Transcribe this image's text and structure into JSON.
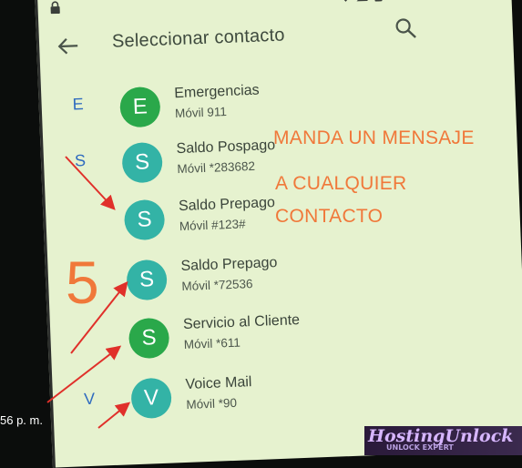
{
  "app": {
    "title": "Seleccionar contacto"
  },
  "contacts": [
    {
      "section": "E",
      "avatar": "E",
      "name": "Emergencias",
      "phone": "Móvil 911",
      "color": "#2aa84a"
    },
    {
      "section": "S",
      "avatar": "S",
      "name": "Saldo Pospago",
      "phone": "Móvil *283682",
      "color": "#33b3a6"
    },
    {
      "section": "",
      "avatar": "S",
      "name": "Saldo Prepago",
      "phone": "Móvil #123#",
      "color": "#33b3a6"
    },
    {
      "section": "",
      "avatar": "S",
      "name": "Saldo Prepago",
      "phone": "Móvil *72536",
      "color": "#33b3a6"
    },
    {
      "section": "",
      "avatar": "S",
      "name": "Servicio al Cliente",
      "phone": "Móvil *611",
      "color": "#2aa84a"
    },
    {
      "section": "V",
      "avatar": "V",
      "name": "Voice Mail",
      "phone": "Móvil *90",
      "color": "#33b3a6"
    }
  ],
  "overlay": {
    "line1": "MANDA   UN MENSAJE",
    "line2": "A CUALQUIER",
    "line3": "CONTACTO",
    "step_number": "5",
    "time": "56 p. m.",
    "watermark": "HostingUnlock",
    "watermark_sub": "UNLOCK EXPERT"
  },
  "colors": {
    "screen_bg": "#e6f2cf",
    "annotation": "#f0783a",
    "arrow": "#e0302a",
    "section_letter": "#2f6bbf"
  },
  "icons": [
    "lock-icon",
    "wifi-icon",
    "battery-icon",
    "back-arrow-icon",
    "search-icon"
  ]
}
